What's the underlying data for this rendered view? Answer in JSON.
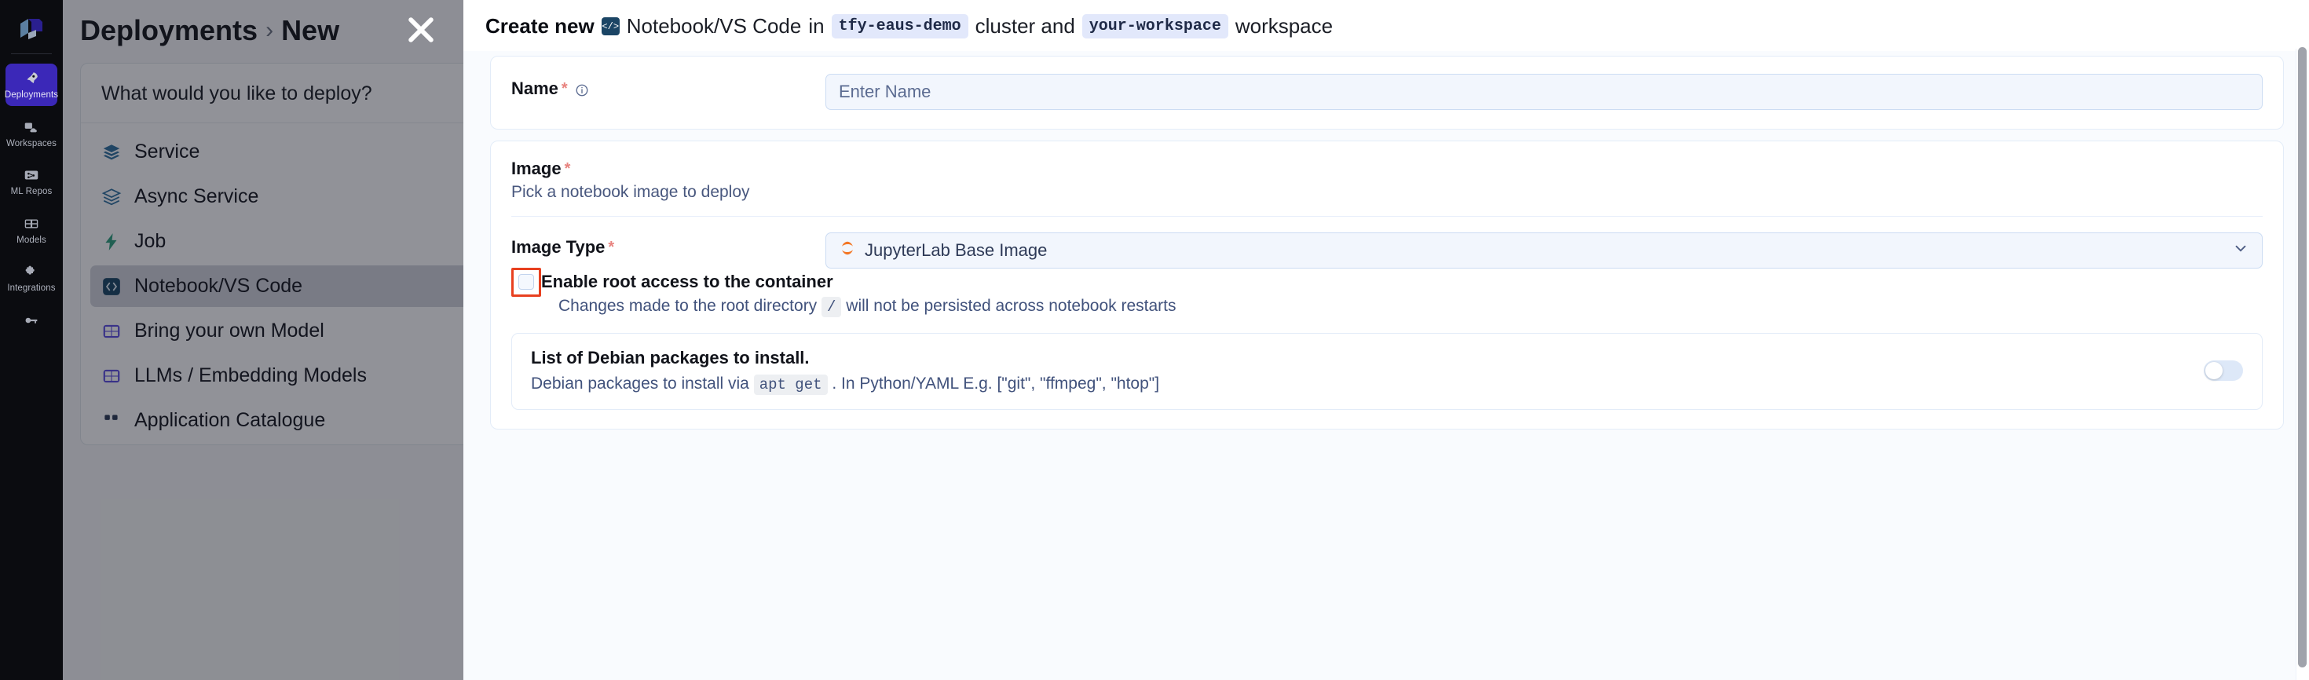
{
  "sidebar": {
    "logo_name": "truefoundry-logo",
    "items": [
      {
        "label": "Deployments",
        "icon": "rocket-icon",
        "active": true
      },
      {
        "label": "Workspaces",
        "icon": "workspaces-icon",
        "active": false
      },
      {
        "label": "ML Repos",
        "icon": "ml-repos-icon",
        "active": false
      },
      {
        "label": "Models",
        "icon": "models-icon",
        "active": false
      },
      {
        "label": "Integrations",
        "icon": "puzzle-icon",
        "active": false
      },
      {
        "label": "",
        "icon": "key-icon",
        "active": false
      }
    ]
  },
  "breadcrumb": {
    "root": "Deployments",
    "separator": "›",
    "current": "New"
  },
  "background_panel": {
    "heading": "What would you like to deploy?",
    "options": [
      {
        "label": "Service",
        "icon": "layers-icon",
        "selected": false
      },
      {
        "label": "Async Service",
        "icon": "layers-outline-icon",
        "selected": false
      },
      {
        "label": "Job",
        "icon": "bolt-icon",
        "selected": false
      },
      {
        "label": "Notebook/VS Code",
        "icon": "code-icon",
        "selected": true
      },
      {
        "label": "Bring your own Model",
        "icon": "grid-icon",
        "selected": false
      },
      {
        "label": "LLMs / Embedding Models",
        "icon": "grid-icon",
        "selected": false
      },
      {
        "label": "Application Catalogue",
        "icon": "dots-icon",
        "selected": false
      }
    ]
  },
  "modal": {
    "close_icon": "close-icon",
    "title": {
      "action": "Create new",
      "type_icon": "code-badge-icon",
      "type": "Notebook/VS Code",
      "in_word": "in",
      "cluster": "tfy-eaus-demo",
      "cluster_word": "cluster and",
      "workspace": "your-workspace",
      "workspace_word": "workspace"
    },
    "name_field": {
      "label": "Name",
      "required_marker": "*",
      "info_icon": "info-icon",
      "placeholder": "Enter Name",
      "value": ""
    },
    "image_section": {
      "label": "Image",
      "required_marker": "*",
      "hint": "Pick a notebook image to deploy",
      "image_type": {
        "label": "Image Type",
        "required_marker": "*",
        "selected": "JupyterLab Base Image",
        "selected_icon": "jupyter-icon",
        "caret_icon": "chevron-down-icon"
      },
      "root_access": {
        "checked": false,
        "label": "Enable root access to the container",
        "sub_prefix": "Changes made to the root directory",
        "sub_code": "/",
        "sub_suffix": "will not be persisted across notebook restarts",
        "highlighted": true,
        "highlight_color": "#e8401f"
      },
      "debian_packages": {
        "title": "List of Debian packages to install.",
        "sub_prefix": "Debian packages to install via",
        "sub_code": "apt get",
        "sub_suffix": ". In Python/YAML E.g. [\"git\", \"ffmpeg\", \"htop\"]",
        "toggle_on": false
      }
    }
  },
  "colors": {
    "accent": "#3b28b8",
    "highlight": "#e8401f",
    "chip_bg": "#e2e8fb",
    "link_text": "#41527c"
  }
}
